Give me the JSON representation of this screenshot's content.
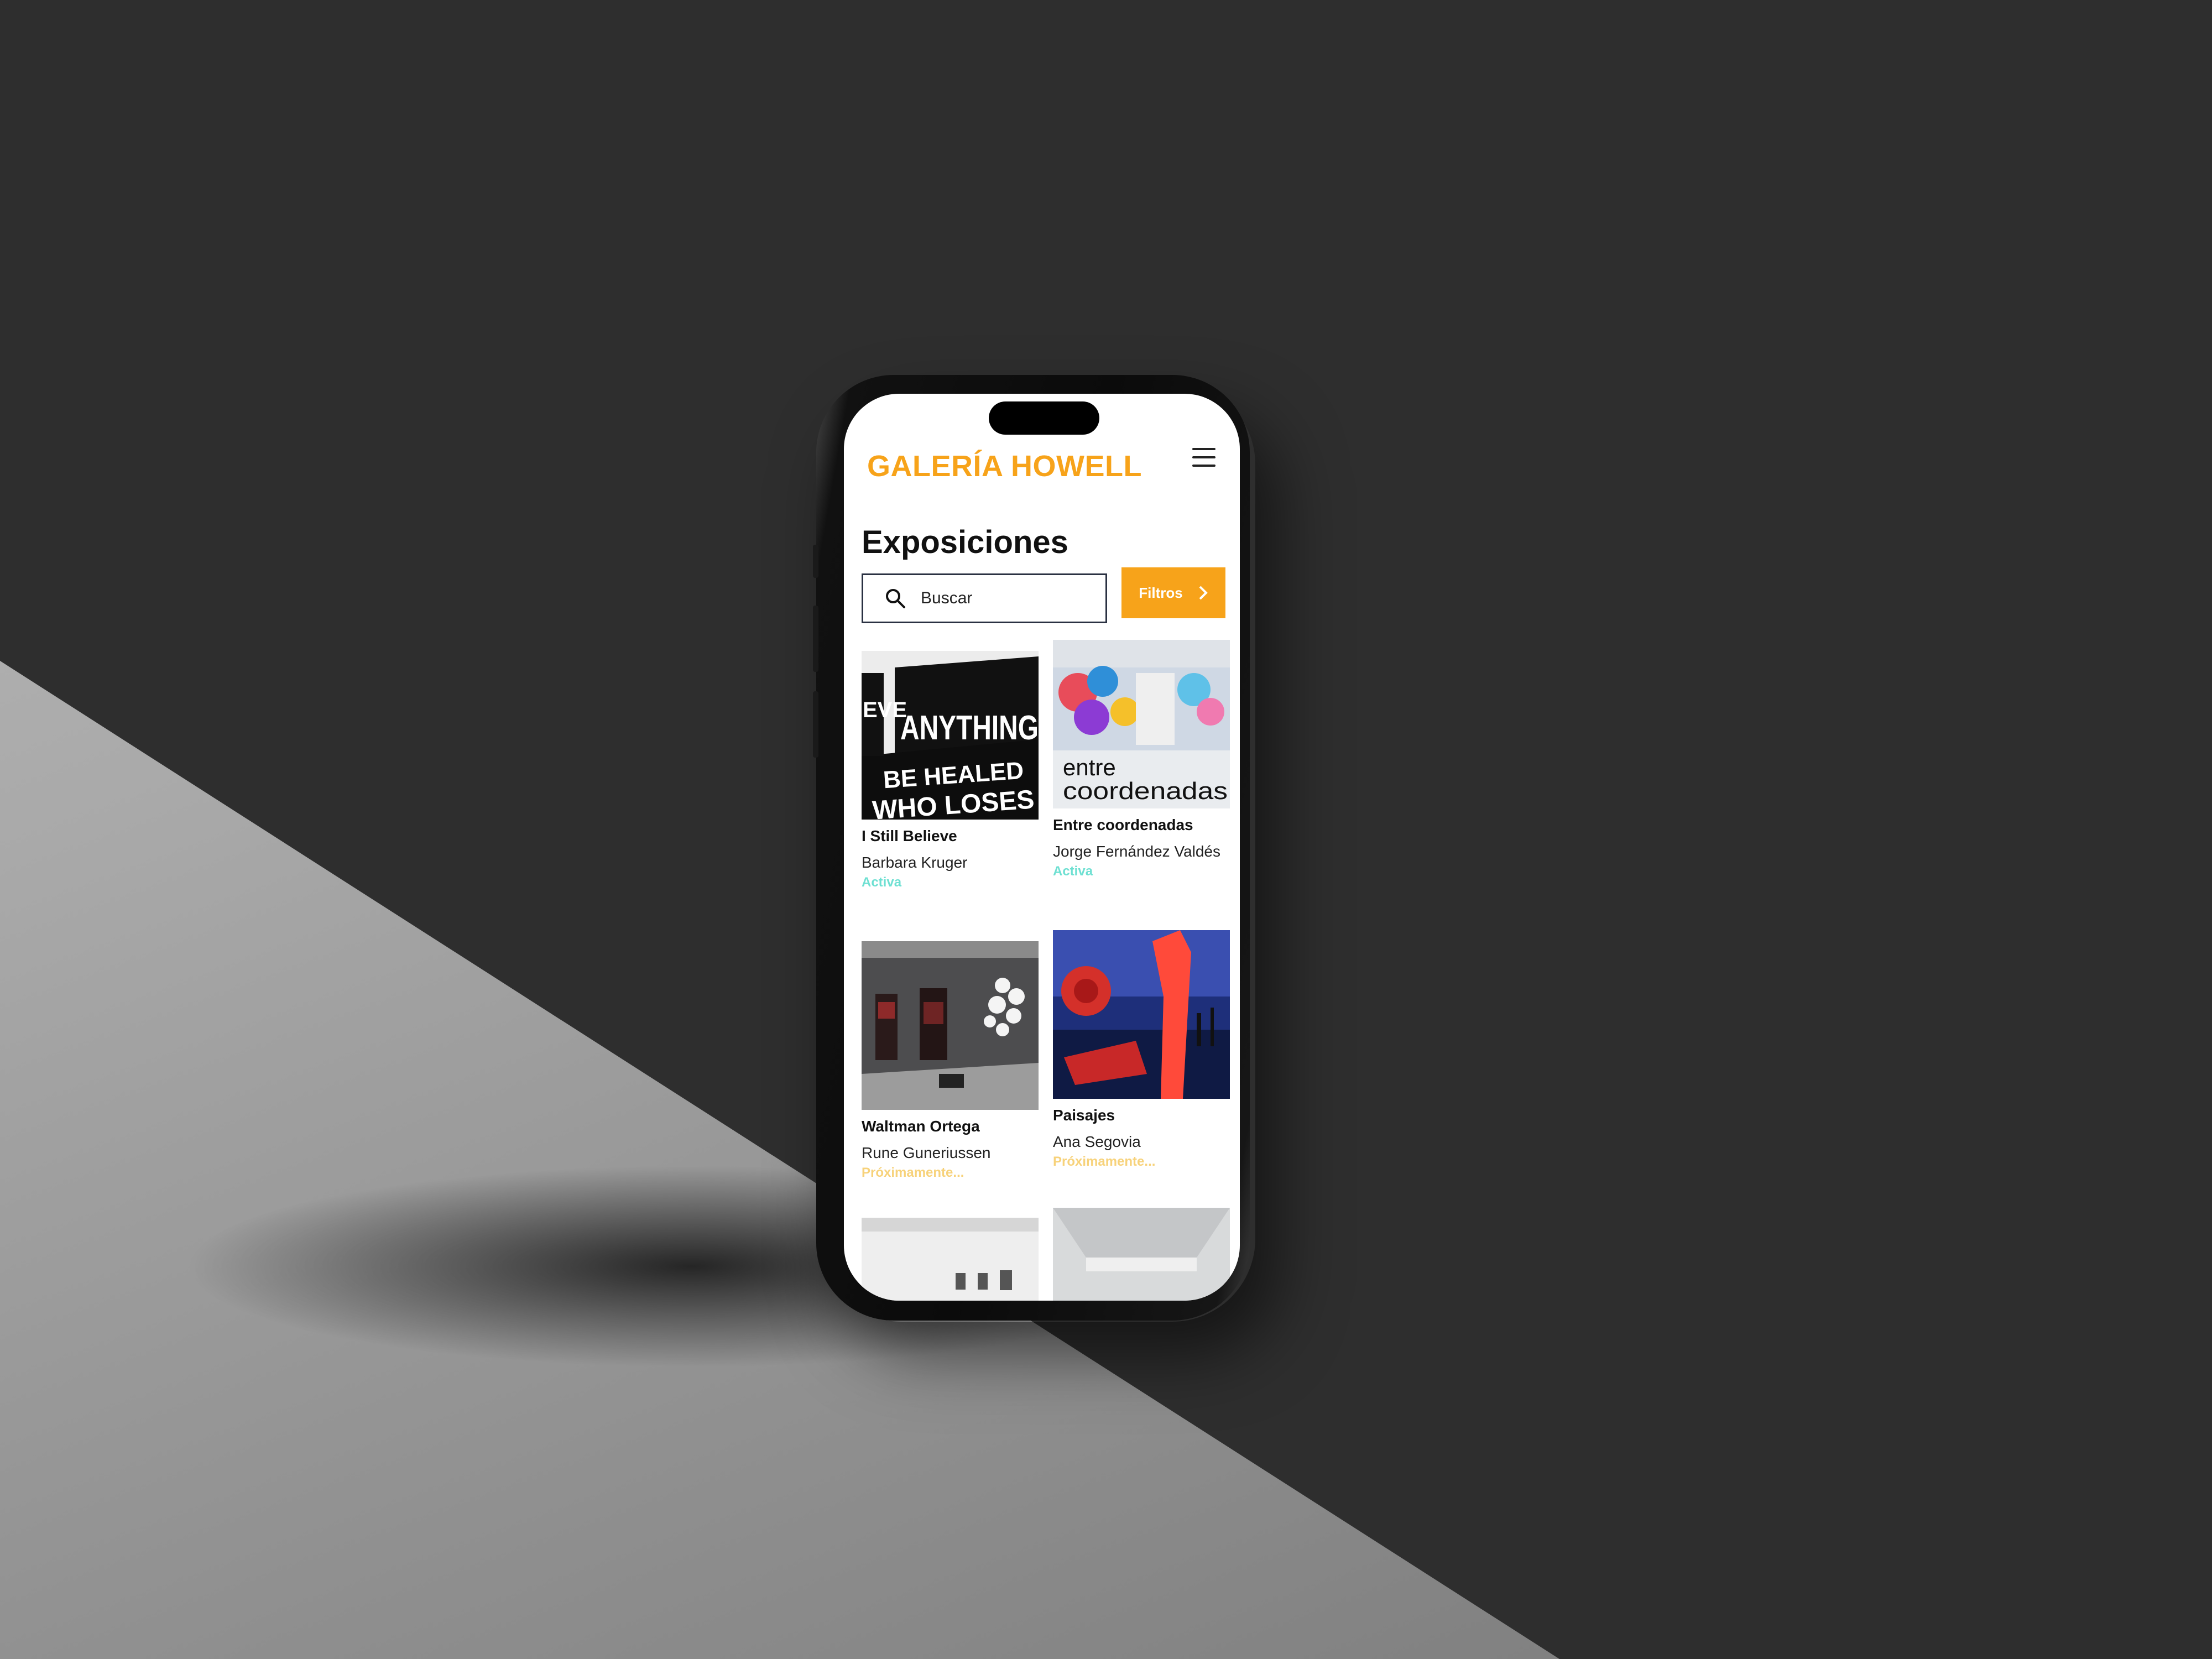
{
  "header": {
    "brand": "GALERÍA HOWELL"
  },
  "page": {
    "title": "Exposiciones"
  },
  "search": {
    "placeholder": "Buscar"
  },
  "filters": {
    "label": "Filtros"
  },
  "exhibitions": [
    {
      "title": "I Still Believe",
      "artist": "Barbara Kruger",
      "status": "Activa"
    },
    {
      "title": "Entre coordenadas",
      "artist": "Jorge Fernández Valdés",
      "status": "Activa"
    },
    {
      "title": "Waltman Ortega",
      "artist": "Rune Guneriussen",
      "status": "Próximamente..."
    },
    {
      "title": "Paisajes",
      "artist": "Ana Segovia",
      "status": "Próximamente..."
    }
  ],
  "thumbs": {
    "kruger_words": [
      "ANYTHING",
      "BE HEALED",
      "WHO LOSES",
      "EVE"
    ],
    "coordenadas_words": [
      "entre",
      "coordenadas"
    ]
  },
  "colors": {
    "accent": "#f7a31a",
    "active": "#6ee0d2",
    "soon": "#f7d27a",
    "background": "#2e2e2e"
  }
}
